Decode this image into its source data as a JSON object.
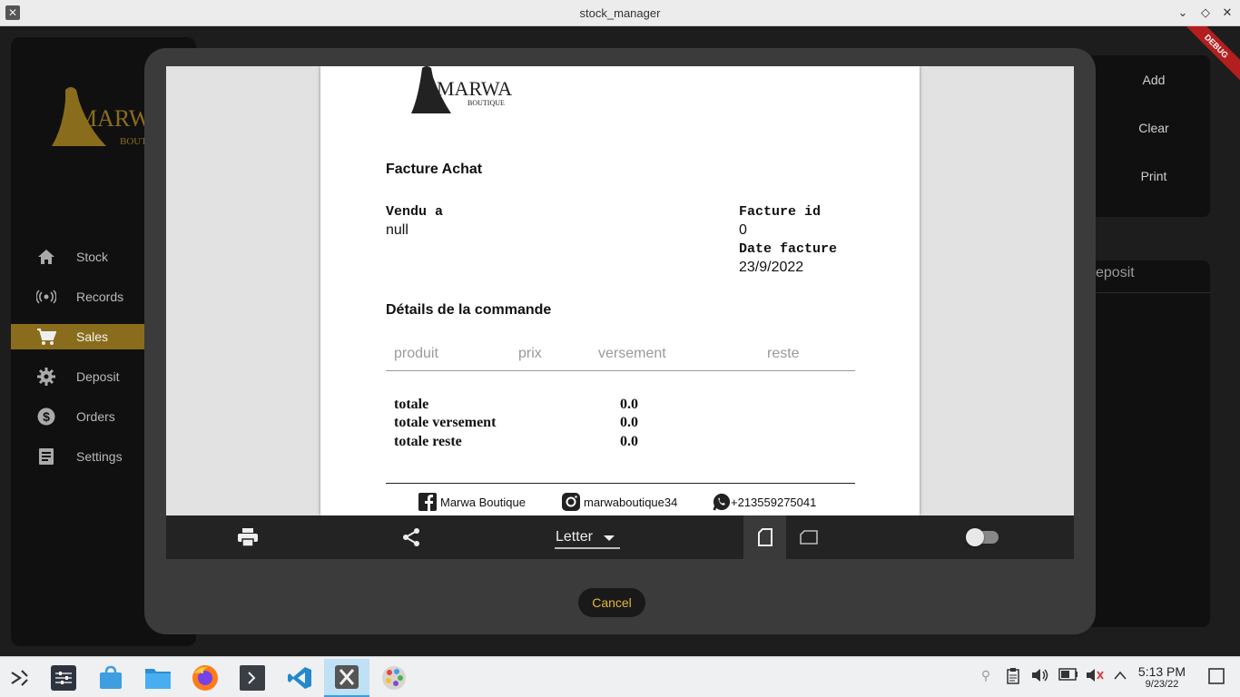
{
  "window": {
    "title": "stock_manager"
  },
  "sidebar": {
    "items": [
      {
        "label": "Stock",
        "icon": "home-icon"
      },
      {
        "label": "Records",
        "icon": "broadcast-icon"
      },
      {
        "label": "Sales",
        "icon": "cart-icon",
        "active": true
      },
      {
        "label": "Deposit",
        "icon": "gear-icon"
      },
      {
        "label": "Orders",
        "icon": "dollar-icon"
      },
      {
        "label": "Settings",
        "icon": "list-icon"
      }
    ]
  },
  "right_panel": {
    "add": "Add",
    "clear": "Clear",
    "print": "Print"
  },
  "deposit_panel": {
    "header": "eposit"
  },
  "debug_banner": "DEBUG",
  "invoice": {
    "logo_text": "MARWA",
    "logo_sub": "BOUTIQUE",
    "title": "Facture Achat",
    "sold_to_label": "Vendu a",
    "sold_to_value": "null",
    "invoice_id_label": "Facture id",
    "invoice_id_value": "0",
    "date_label": "Date facture",
    "date_value": "23/9/2022",
    "details_title": "Détails de la commande",
    "columns": [
      "produit",
      "prix",
      "versement",
      "reste"
    ],
    "totals": [
      {
        "label": "totale",
        "value": "0.0"
      },
      {
        "label": "totale versement",
        "value": "0.0"
      },
      {
        "label": "totale reste",
        "value": "0.0"
      }
    ],
    "footer": {
      "facebook": "Marwa Boutique",
      "instagram": "marwaboutique34",
      "whatsapp": "+213559275041"
    }
  },
  "print_toolbar": {
    "paper_size": "Letter"
  },
  "dialog": {
    "cancel": "Cancel"
  },
  "taskbar": {
    "time": "5:13 PM",
    "date": "9/23/22"
  },
  "colors": {
    "accent": "#8a6d1c",
    "cancel_text": "#e0b83b",
    "debug": "#b31e1e"
  }
}
